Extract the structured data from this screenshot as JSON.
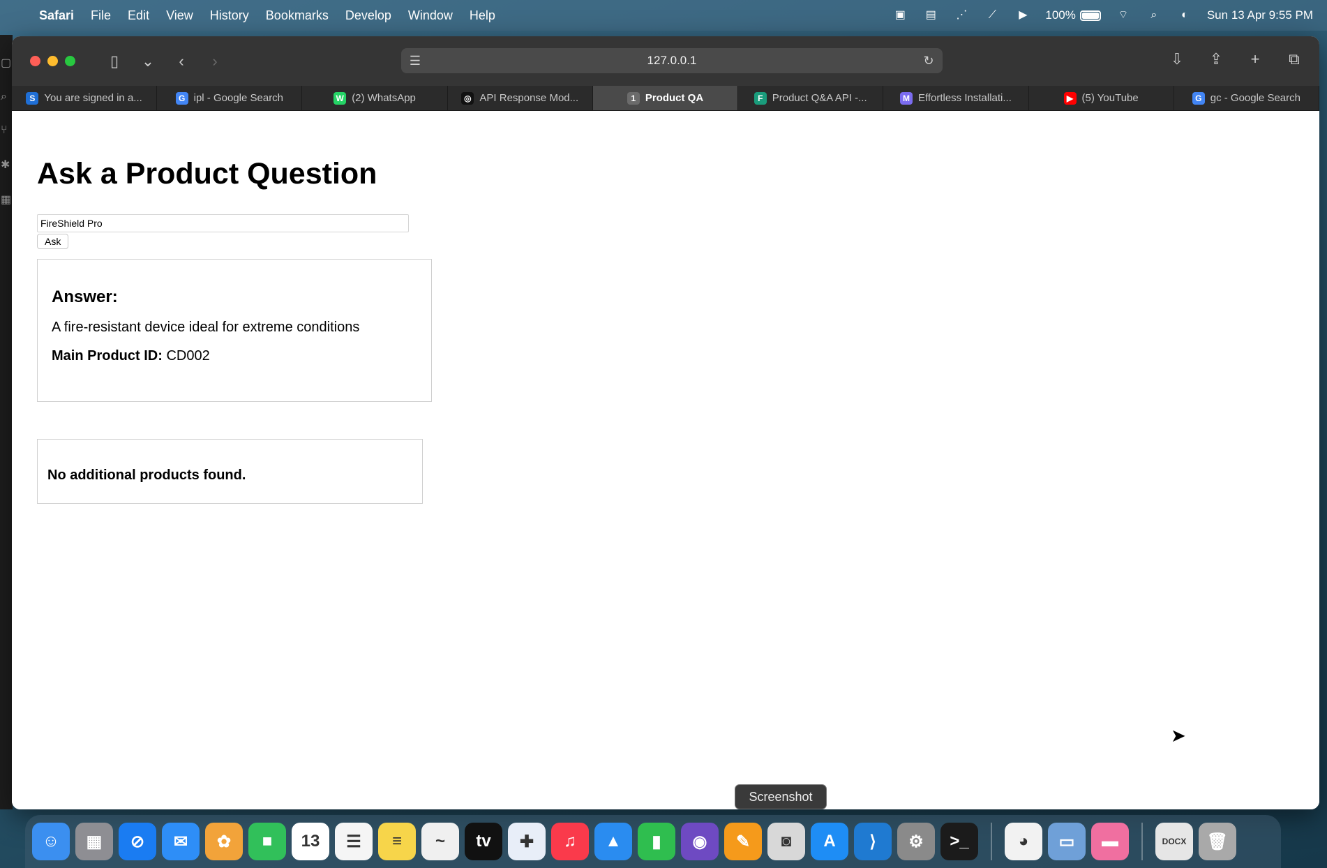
{
  "menubar": {
    "app_name": "Safari",
    "items": [
      "File",
      "Edit",
      "View",
      "History",
      "Bookmarks",
      "Develop",
      "Window",
      "Help"
    ],
    "battery": "100%",
    "clock": "Sun 13 Apr  9:55 PM"
  },
  "browser": {
    "url": "127.0.0.1",
    "tabs": [
      {
        "label": "You are signed in a...",
        "favicon": "S",
        "color": "#1f6fd6"
      },
      {
        "label": "ipl - Google Search",
        "favicon": "G",
        "color": "#4285f4"
      },
      {
        "label": "(2) WhatsApp",
        "favicon": "W",
        "color": "#25d366"
      },
      {
        "label": "API Response Mod...",
        "favicon": "◎",
        "color": "#111111"
      },
      {
        "label": "Product QA",
        "favicon": "1",
        "color": "#6b6b6b"
      },
      {
        "label": "Product Q&A API -...",
        "favicon": "F",
        "color": "#1a9c7c"
      },
      {
        "label": "Effortless Installati...",
        "favicon": "M",
        "color": "#7b6cf0"
      },
      {
        "label": "(5) YouTube",
        "favicon": "▶",
        "color": "#ff0000"
      },
      {
        "label": "gc - Google Search",
        "favicon": "G",
        "color": "#4285f4"
      }
    ],
    "active_tab_index": 4
  },
  "page": {
    "title": "Ask a Product Question",
    "question_value": "FireShield Pro",
    "ask_label": "Ask",
    "answer_heading": "Answer:",
    "answer_text": "A fire-resistant device ideal for extreme conditions",
    "main_id_label": "Main Product ID:",
    "main_id_value": "CD002",
    "no_additional": "No additional products found."
  },
  "tooltip": "Screenshot",
  "dock": {
    "apps": [
      {
        "name": "finder",
        "color": "#3b8ff0",
        "glyph": "☺"
      },
      {
        "name": "launchpad",
        "color": "#8e8e93",
        "glyph": "▦"
      },
      {
        "name": "safari",
        "color": "#1a7cf2",
        "glyph": "⊘"
      },
      {
        "name": "mail",
        "color": "#2e8ef7",
        "glyph": "✉"
      },
      {
        "name": "photos",
        "color": "#f2a33a",
        "glyph": "✿"
      },
      {
        "name": "facetime",
        "color": "#31c05a",
        "glyph": "■"
      },
      {
        "name": "calendar",
        "color": "#ffffff",
        "glyph": "13"
      },
      {
        "name": "reminders",
        "color": "#f5f5f5",
        "glyph": "☰"
      },
      {
        "name": "notes",
        "color": "#f7d54a",
        "glyph": "≡"
      },
      {
        "name": "freeform",
        "color": "#f0f0f0",
        "glyph": "~"
      },
      {
        "name": "tv",
        "color": "#111111",
        "glyph": "tv"
      },
      {
        "name": "tableau",
        "color": "#e8eef8",
        "glyph": "✚"
      },
      {
        "name": "music",
        "color": "#fa3a4b",
        "glyph": "♫"
      },
      {
        "name": "keynote",
        "color": "#2a8cf0",
        "glyph": "▲"
      },
      {
        "name": "numbers",
        "color": "#2fbe4f",
        "glyph": "▮"
      },
      {
        "name": "github",
        "color": "#6e4ac2",
        "glyph": "◉"
      },
      {
        "name": "pages",
        "color": "#f59a1b",
        "glyph": "✎"
      },
      {
        "name": "screenshot",
        "color": "#d8d8d8",
        "glyph": "◙"
      },
      {
        "name": "app-store",
        "color": "#1e8df5",
        "glyph": "A"
      },
      {
        "name": "vscode",
        "color": "#1f7ad1",
        "glyph": "⟩"
      },
      {
        "name": "system-settings",
        "color": "#8a8a8a",
        "glyph": "⚙"
      },
      {
        "name": "terminal",
        "color": "#1b1b1b",
        "glyph": ">_"
      }
    ],
    "recent": [
      {
        "name": "ollama",
        "color": "#f2f2f2",
        "glyph": "◕"
      },
      {
        "name": "preview",
        "color": "#6fa0d8",
        "glyph": "▭"
      },
      {
        "name": "mac-app",
        "color": "#f06fa0",
        "glyph": "▬"
      }
    ],
    "docs": [
      {
        "name": "docx-file",
        "color": "#e6e6e6",
        "glyph": "DOCX"
      },
      {
        "name": "trash",
        "color": "#a9a9a9",
        "glyph": "🗑"
      }
    ]
  }
}
